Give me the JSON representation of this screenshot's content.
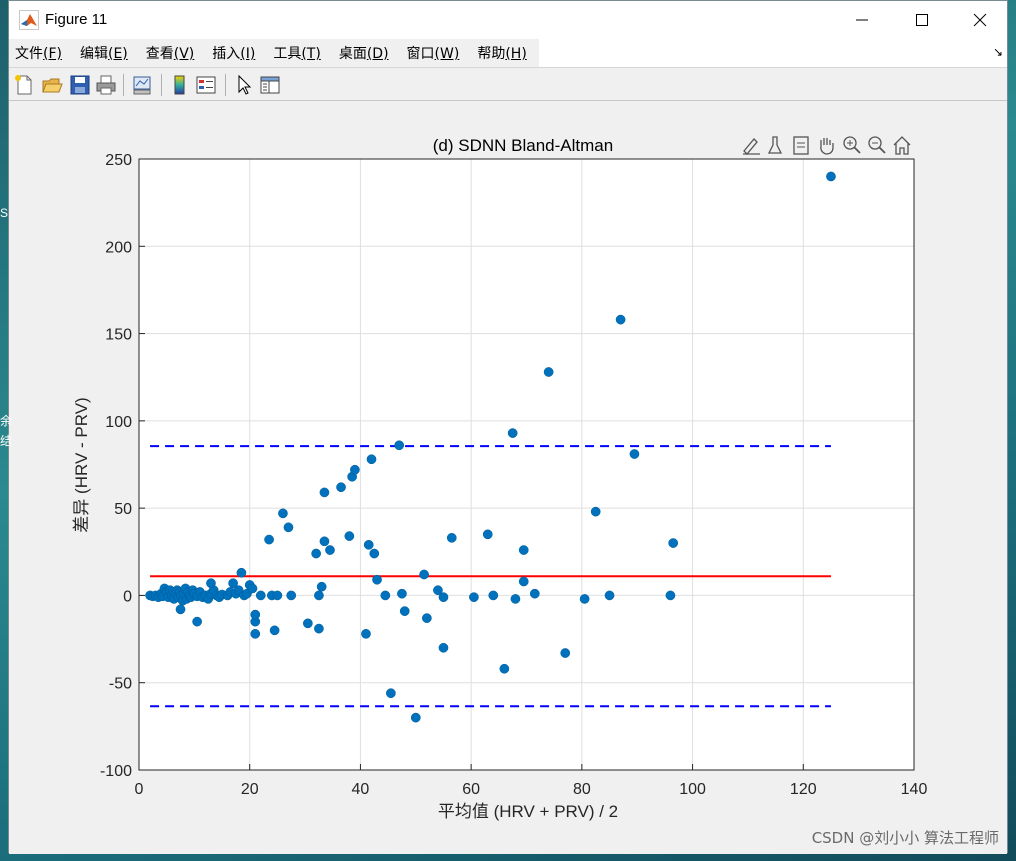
{
  "window": {
    "title": "Figure 11"
  },
  "menu": {
    "items": [
      {
        "label": "文件",
        "key": "(F)"
      },
      {
        "label": "编辑",
        "key": "(E)"
      },
      {
        "label": "查看",
        "key": "(V)"
      },
      {
        "label": "插入",
        "key": "(I)"
      },
      {
        "label": "工具",
        "key": "(T)"
      },
      {
        "label": "桌面",
        "key": "(D)"
      },
      {
        "label": "窗口",
        "key": "(W)"
      },
      {
        "label": "帮助",
        "key": "(H)"
      }
    ]
  },
  "toolbar": {
    "icons": [
      "new-figure-icon",
      "open-file-icon",
      "save-icon",
      "print-icon",
      "link-plot-icon",
      "colorbar-icon",
      "legend-icon",
      "select-arrow-icon",
      "property-inspector-icon"
    ]
  },
  "axes_toolbar": {
    "icons": [
      "edit-brush-icon",
      "data-brush-icon",
      "data-tips-icon",
      "pan-hand-icon",
      "zoom-in-icon",
      "zoom-out-icon",
      "home-icon"
    ]
  },
  "desktop_fragments": [
    "S",
    "余",
    "结"
  ],
  "watermark": "CSDN @刘小小 算法工程师",
  "chart_data": {
    "type": "scatter",
    "title": "(d) SDNN Bland-Altman",
    "xlabel": "平均值 (HRV + PRV) / 2",
    "ylabel": "差异 (HRV - PRV)",
    "xlim": [
      0,
      140
    ],
    "ylim": [
      -100,
      250
    ],
    "xticks": [
      0,
      20,
      40,
      60,
      80,
      100,
      120,
      140
    ],
    "yticks": [
      -100,
      -50,
      0,
      50,
      100,
      150,
      200,
      250
    ],
    "grid": true,
    "colors": {
      "points": "#0072BD",
      "mean_line": "#FF0000",
      "loa_lines": "#0000FF"
    },
    "mean_line": {
      "y": 11,
      "x": [
        2,
        125
      ]
    },
    "limits_of_agreement": [
      {
        "y": 85.5,
        "x": [
          2,
          125
        ]
      },
      {
        "y": -63.5,
        "x": [
          2,
          125
        ]
      }
    ],
    "points": [
      [
        2,
        0
      ],
      [
        2.5,
        -0.5
      ],
      [
        3,
        0
      ],
      [
        3.5,
        -1
      ],
      [
        4,
        1
      ],
      [
        4.3,
        -0.5
      ],
      [
        4.6,
        4
      ],
      [
        5,
        2
      ],
      [
        5.3,
        -1
      ],
      [
        5.6,
        3
      ],
      [
        5.9,
        0
      ],
      [
        6.1,
        2
      ],
      [
        6.3,
        -2
      ],
      [
        6.6,
        1
      ],
      [
        6.9,
        3
      ],
      [
        7.1,
        -1
      ],
      [
        7.4,
        2
      ],
      [
        7.6,
        0
      ],
      [
        7.9,
        -3
      ],
      [
        8.1,
        1
      ],
      [
        8.4,
        4
      ],
      [
        8.6,
        -2
      ],
      [
        8.9,
        2
      ],
      [
        9.1,
        0
      ],
      [
        9.4,
        -1
      ],
      [
        9.7,
        3
      ],
      [
        10,
        1
      ],
      [
        10.5,
        -0.5
      ],
      [
        11,
        2
      ],
      [
        11.5,
        -1
      ],
      [
        12,
        0
      ],
      [
        12.5,
        -2
      ],
      [
        13,
        1
      ],
      [
        13.5,
        3
      ],
      [
        14,
        0
      ],
      [
        14.5,
        -1
      ],
      [
        15,
        0.5
      ],
      [
        7.5,
        -8
      ],
      [
        10.5,
        -15
      ],
      [
        13,
        7
      ],
      [
        16,
        0
      ],
      [
        16.5,
        2
      ],
      [
        17,
        7
      ],
      [
        17.5,
        1
      ],
      [
        18,
        3
      ],
      [
        18.5,
        13
      ],
      [
        19,
        0
      ],
      [
        19.5,
        1
      ],
      [
        20,
        6
      ],
      [
        20.5,
        4
      ],
      [
        21,
        -15
      ],
      [
        21,
        -22
      ],
      [
        21,
        -11
      ],
      [
        22,
        0
      ],
      [
        23.5,
        32
      ],
      [
        24,
        0
      ],
      [
        24.5,
        -20
      ],
      [
        25,
        0
      ],
      [
        26,
        47
      ],
      [
        27,
        39
      ],
      [
        27.5,
        0
      ],
      [
        30.5,
        -16
      ],
      [
        32,
        24
      ],
      [
        32.5,
        -19
      ],
      [
        32.5,
        0
      ],
      [
        33,
        5
      ],
      [
        33.5,
        31
      ],
      [
        33.5,
        59
      ],
      [
        34.5,
        26
      ],
      [
        36.5,
        62
      ],
      [
        38,
        34
      ],
      [
        38.5,
        68
      ],
      [
        39,
        72
      ],
      [
        41,
        -22
      ],
      [
        41.5,
        29
      ],
      [
        42,
        78
      ],
      [
        42.5,
        24
      ],
      [
        43,
        9
      ],
      [
        44.5,
        0
      ],
      [
        45.5,
        -56
      ],
      [
        47,
        86
      ],
      [
        47.5,
        1
      ],
      [
        48,
        -9
      ],
      [
        50,
        -70
      ],
      [
        51.5,
        12
      ],
      [
        52,
        -13
      ],
      [
        54,
        3
      ],
      [
        55,
        -30
      ],
      [
        55,
        -1
      ],
      [
        56.5,
        33
      ],
      [
        60.5,
        -1
      ],
      [
        63,
        35
      ],
      [
        64,
        0
      ],
      [
        66,
        -42
      ],
      [
        67.5,
        93
      ],
      [
        68,
        -2
      ],
      [
        69.5,
        26
      ],
      [
        69.5,
        8
      ],
      [
        71.5,
        1
      ],
      [
        74,
        128
      ],
      [
        77,
        -33
      ],
      [
        80.5,
        -2
      ],
      [
        82.5,
        48
      ],
      [
        85,
        0
      ],
      [
        87,
        158
      ],
      [
        89.5,
        81
      ],
      [
        96,
        0
      ],
      [
        96.5,
        30
      ],
      [
        125,
        240
      ]
    ]
  }
}
